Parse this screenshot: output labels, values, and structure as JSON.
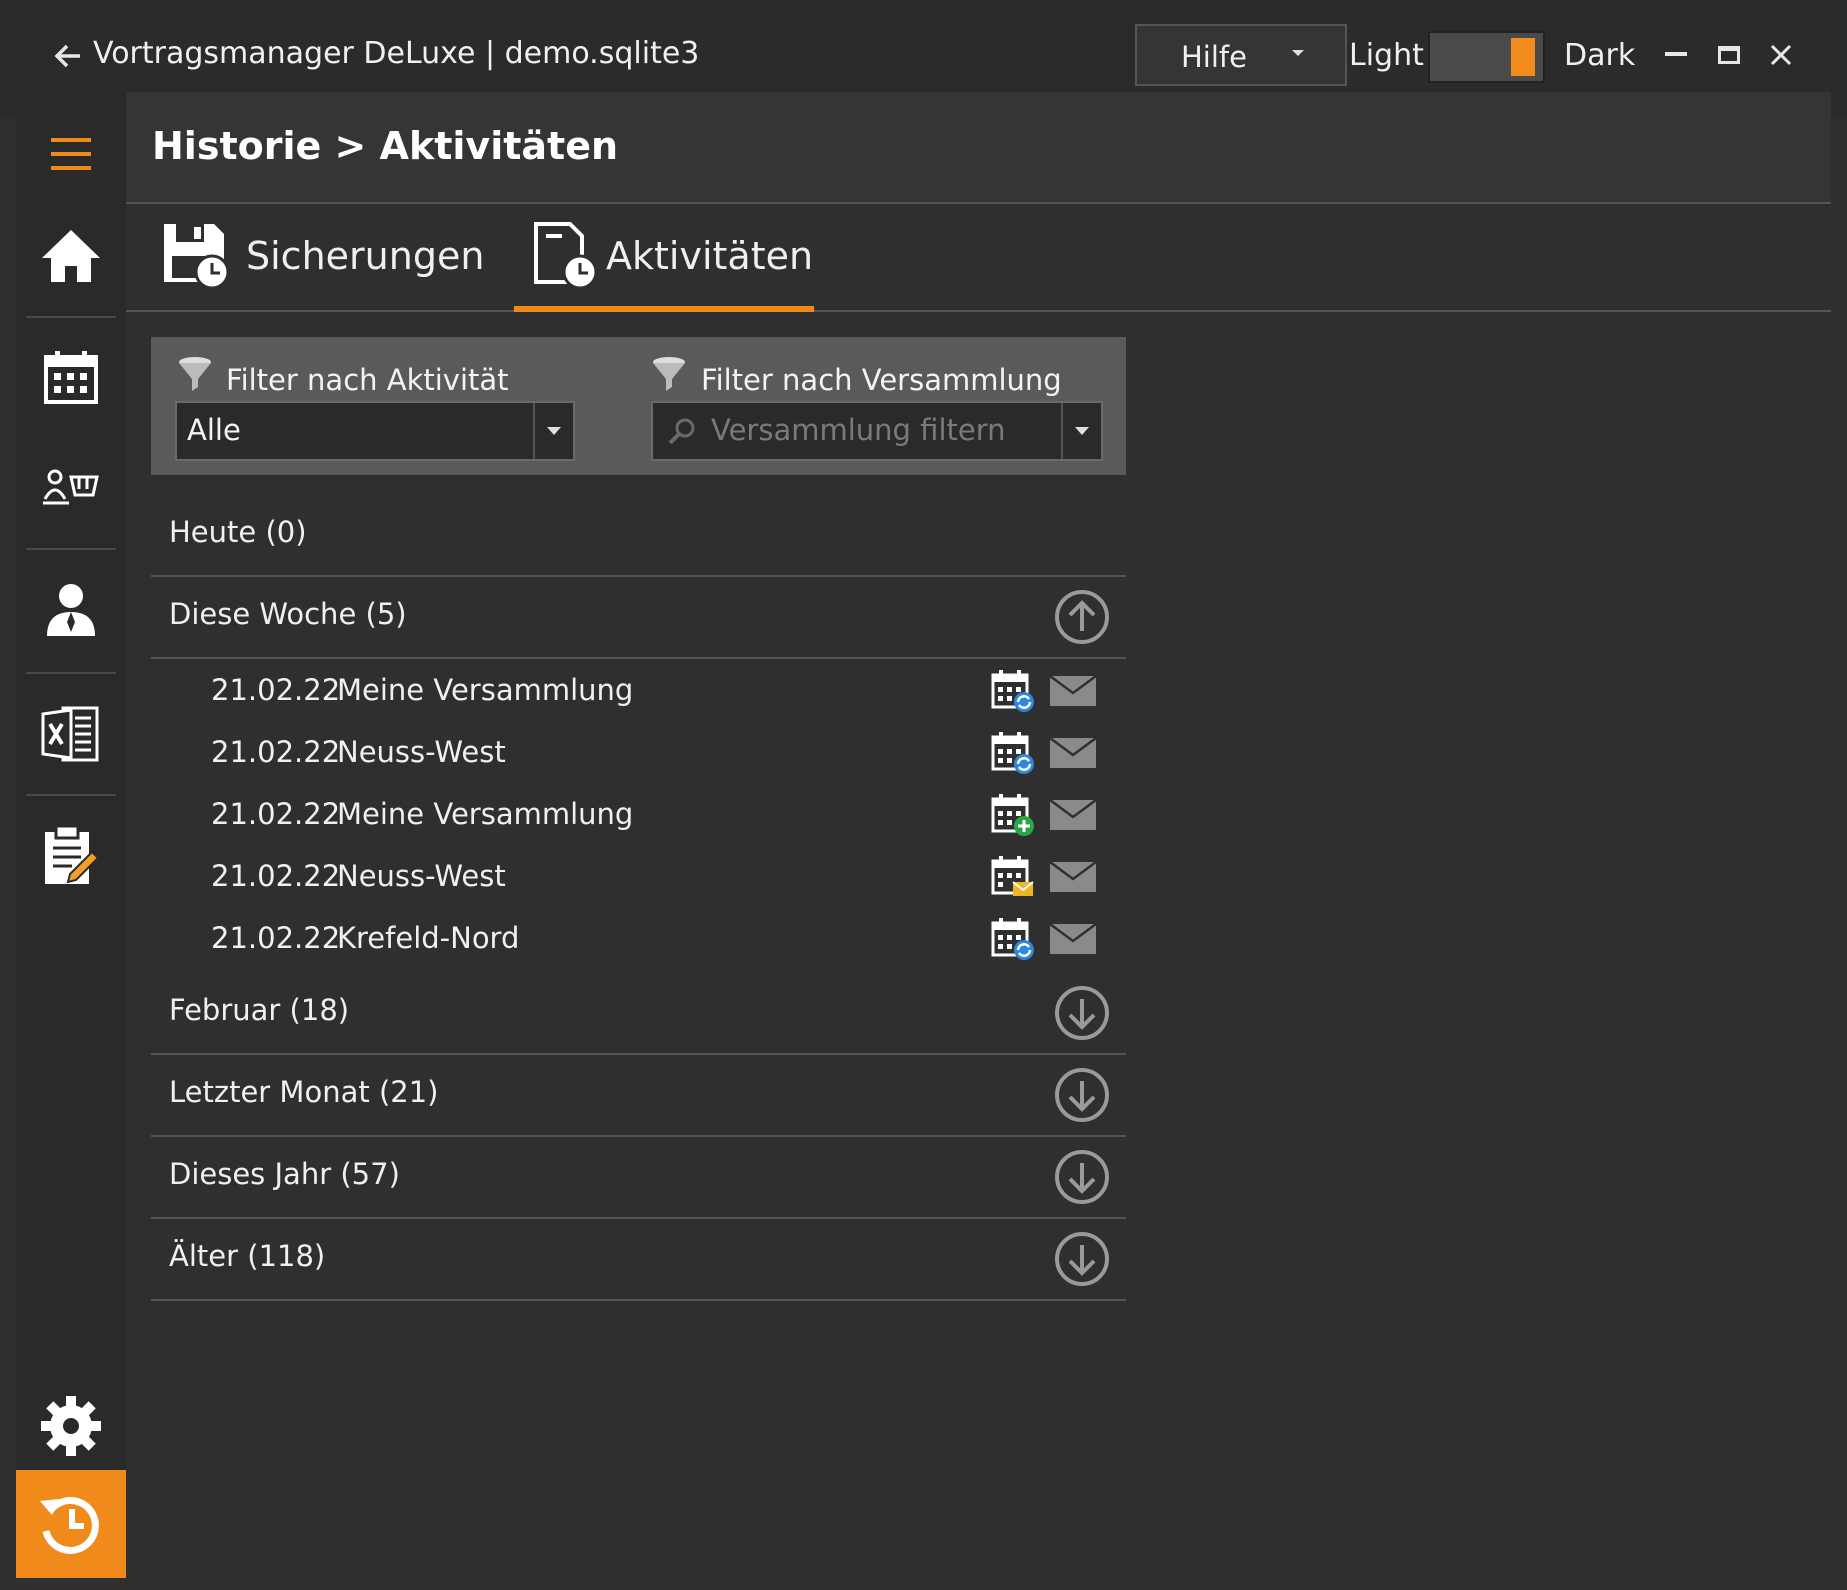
{
  "window": {
    "title": "Vortragsmanager DeLuxe | demo.sqlite3",
    "help_menu": "Hilfe",
    "theme_light": "Light",
    "theme_dark": "Dark"
  },
  "colors": {
    "accent": "#f08a1a",
    "background": "#2f2f2f",
    "panel": "#5a5a5a"
  },
  "nav": {
    "items": [
      {
        "icon": "hamburger-menu-icon"
      },
      {
        "icon": "home-icon"
      },
      {
        "icon": "calendar-icon"
      },
      {
        "icon": "speakers-icon"
      },
      {
        "icon": "person-icon"
      },
      {
        "icon": "excel-icon"
      },
      {
        "icon": "clipboard-icon"
      },
      {
        "icon": "settings-gear-icon"
      },
      {
        "icon": "history-icon",
        "active": true
      }
    ]
  },
  "header": {
    "breadcrumb": "Historie > Aktivitäten"
  },
  "tabs": [
    {
      "label": "Sicherungen",
      "icon": "save-history-icon",
      "active": false
    },
    {
      "label": "Aktivitäten",
      "icon": "document-history-icon",
      "active": true
    }
  ],
  "filters": {
    "activity_label": "Filter nach Aktivität",
    "activity_value": "Alle",
    "congregation_label": "Filter nach Versammlung",
    "congregation_placeholder": "Versammlung filtern"
  },
  "groups": [
    {
      "title": "Heute (0)",
      "expandable": false
    },
    {
      "title": "Diese Woche (5)",
      "expanded": true,
      "toggle": "collapse-up-icon"
    },
    {
      "title": "Februar (18)",
      "expanded": false,
      "toggle": "expand-down-icon"
    },
    {
      "title": "Letzter Monat (21)",
      "expanded": false,
      "toggle": "expand-down-icon"
    },
    {
      "title": "Dieses Jahr (57)",
      "expanded": false,
      "toggle": "expand-down-icon"
    },
    {
      "title": "Älter (118)",
      "expanded": false,
      "toggle": "expand-down-icon"
    }
  ],
  "activities": [
    {
      "date": "21.02.22",
      "name": "Meine Versammlung",
      "type_icon": "calendar-sync-icon"
    },
    {
      "date": "21.02.22",
      "name": "Neuss-West",
      "type_icon": "calendar-sync-icon"
    },
    {
      "date": "21.02.22",
      "name": "Meine Versammlung",
      "type_icon": "calendar-add-icon"
    },
    {
      "date": "21.02.22",
      "name": "Neuss-West",
      "type_icon": "calendar-mail-icon"
    },
    {
      "date": "21.02.22",
      "name": "Krefeld-Nord",
      "type_icon": "calendar-sync-icon"
    }
  ]
}
